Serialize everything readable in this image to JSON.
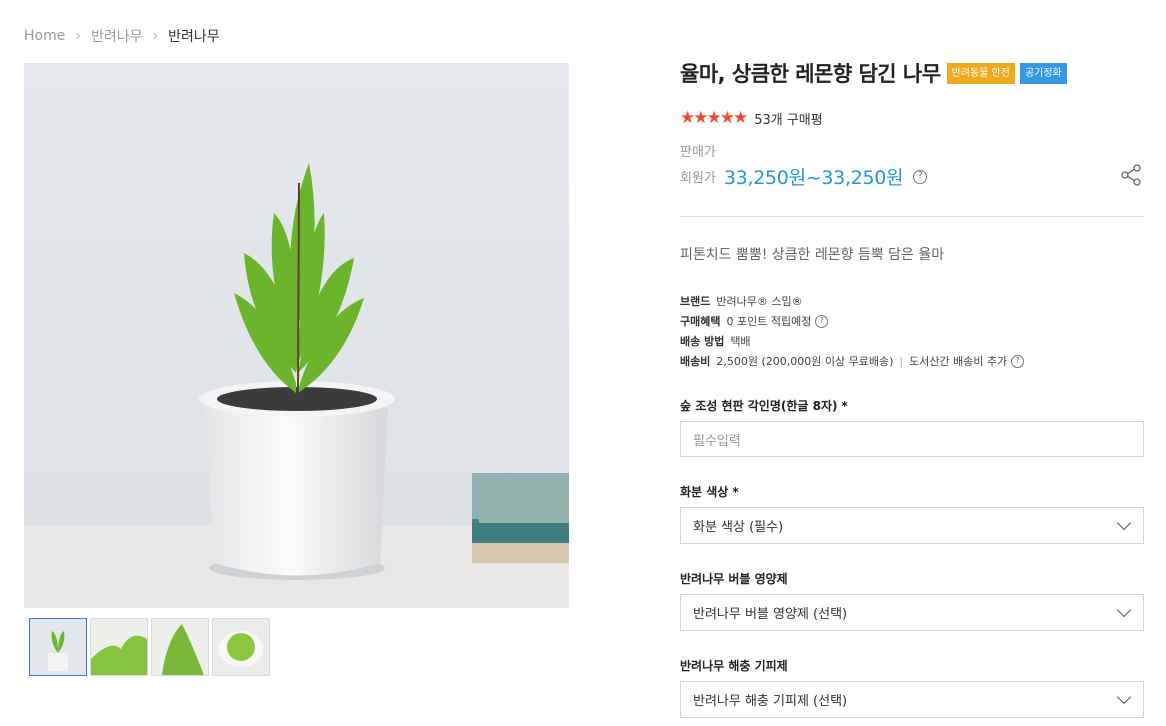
{
  "breadcrumb": {
    "home": "Home",
    "category": "반려나무",
    "current": "반려나무"
  },
  "product": {
    "title": "율마, 상큼한 레몬향 담긴 나무",
    "badges": {
      "pet_safe": "반려동물 안전",
      "air_purify": "공기정화"
    },
    "stars": "★★★★★",
    "review_count": "53개 구매평",
    "sale_label": "판매가",
    "member_label": "회원가",
    "price": "33,250원~33,250원",
    "summary": "피톤치드 뿜뿜! 상큼한 레몬향 듬뿍 담은 율마"
  },
  "info": {
    "brand_label": "브랜드",
    "brand_value": "반려나무® 스밈®",
    "benefit_label": "구매혜택",
    "benefit_value": "0 포인트 적립예정",
    "shipping_method_label": "배송 방법",
    "shipping_method_value": "택배",
    "shipping_fee_label": "배송비",
    "shipping_fee_value": "2,500원 (200,000원 이상 무료배송)",
    "island_fee": "도서산간 배송비 추가"
  },
  "options": {
    "engraving_label": "숲 조성 현판 각인명(한글 8자)",
    "engraving_placeholder": "필수입력",
    "pot_color_label": "화분 색상",
    "pot_color_value": "화분 색상 (필수)",
    "nutrient_label": "반려나무 버블 영양제",
    "nutrient_value": "반려나무 버블 영양제 (선택)",
    "repellent_label": "반려나무 해충 기피제",
    "repellent_value": "반려나무 해충 기피제 (선택)",
    "required_mark": "*"
  },
  "icons": {
    "help": "?",
    "share": "share-icon",
    "chevron": "chevron-down-icon",
    "breadcrumb_sep": "chevron-right-icon"
  },
  "colors": {
    "price": "#1d9ad6",
    "stars": "#ee4b34",
    "pet_badge": "#f0a81d",
    "air_badge": "#3499e3"
  }
}
